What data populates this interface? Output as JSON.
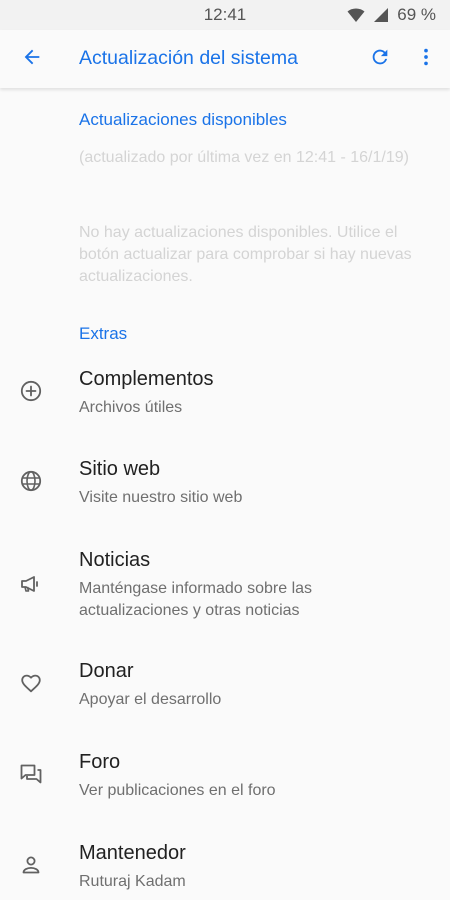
{
  "status_bar": {
    "time": "12:41",
    "battery": "69 %"
  },
  "app_bar": {
    "title": "Actualización del sistema",
    "back_icon": "arrow-back-icon",
    "refresh_icon": "refresh-icon",
    "more_icon": "more-vert-icon"
  },
  "updates": {
    "header": "Actualizaciones disponibles",
    "last_checked": "(actualizado por última vez en 12:41 - 16/1/19)",
    "empty_message": "No hay actualizaciones disponibles. Utilice el botón actualizar para comprobar si hay nuevas actualizaciones."
  },
  "extras": {
    "header": "Extras",
    "items": [
      {
        "title": "Complementos",
        "summary": "Archivos útiles",
        "icon": "add-circle-icon"
      },
      {
        "title": "Sitio web",
        "summary": "Visite nuestro sitio web",
        "icon": "globe-icon"
      },
      {
        "title": "Noticias",
        "summary": "Manténgase informado sobre las actualizaciones y otras noticias",
        "icon": "megaphone-icon"
      },
      {
        "title": "Donar",
        "summary": "Apoyar el desarrollo",
        "icon": "heart-icon"
      },
      {
        "title": "Foro",
        "summary": "Ver publicaciones en el foro",
        "icon": "forum-icon"
      },
      {
        "title": "Mantenedor",
        "summary": "Ruturaj Kadam",
        "icon": "person-icon"
      }
    ]
  },
  "colors": {
    "accent": "#1a73e8",
    "background": "#fafafa",
    "text_primary": "#212121",
    "text_secondary": "#6f6f6f",
    "text_disabled": "#d4d4d4"
  }
}
